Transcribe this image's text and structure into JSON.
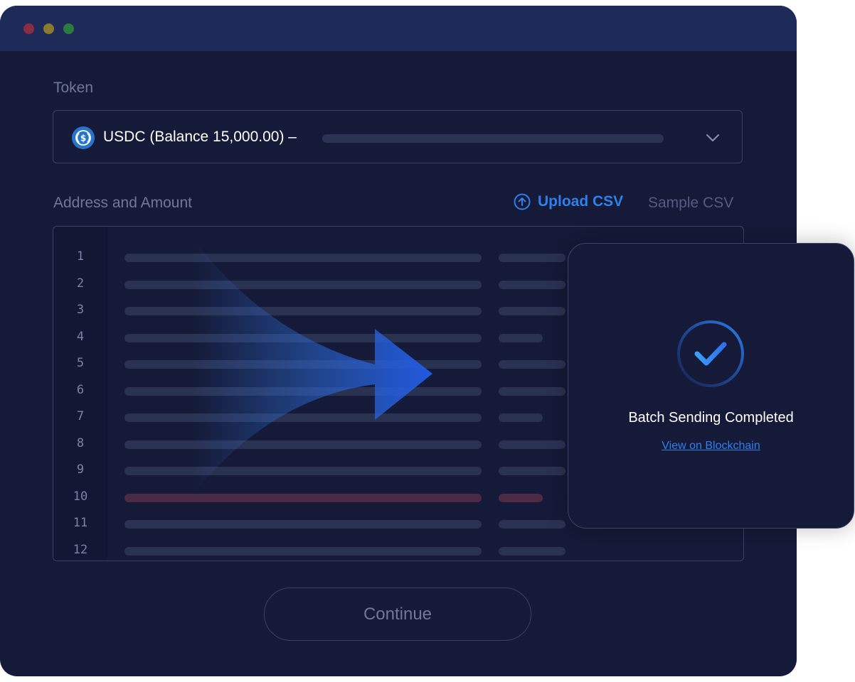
{
  "token_section": {
    "label": "Token",
    "selected": "USDC (Balance 15,000.00) –",
    "icon": "usdc-icon"
  },
  "address_section": {
    "label": "Address and Amount",
    "upload_label": "Upload CSV",
    "sample_label": "Sample CSV"
  },
  "editor": {
    "line_numbers": [
      "1",
      "2",
      "3",
      "4",
      "5",
      "6",
      "7",
      "8",
      "9",
      "10",
      "11",
      "12"
    ]
  },
  "continue_label": "Continue",
  "modal": {
    "title": "Batch Sending Completed",
    "link": "View on Blockchain"
  },
  "colors": {
    "window_bg": "#141a37",
    "titlebar_bg": "#1e2a57",
    "accent": "#2f80ed",
    "error_row": "#4a2a45"
  }
}
